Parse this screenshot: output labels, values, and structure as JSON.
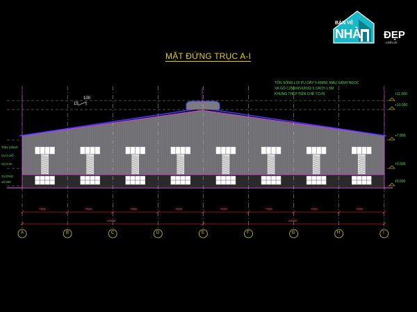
{
  "title": "MẶT ĐỨNG TRỤC A-I",
  "logo": {
    "top_text": "BẢN VẼ",
    "main_text": "NHÀ",
    "accent_text": "ĐẸP",
    "url_text": ".com.vn",
    "color": "#18b8c8"
  },
  "notes": [
    "TÔN SÓNG LỢI PU DÀY 0.45MM, MÀU XANH NGỌC",
    "XÀ GỒ C250X65X20X2.5 CÁCH 1.5M",
    "KHUNG THÉP TIỀN CHẾ TCVN"
  ],
  "elevations": [
    "+11.000",
    "+10.000",
    "+7.800",
    "+3.500",
    "±0.000"
  ],
  "left_labels": [
    "TÔN SÓNG",
    "CỬA SỔ",
    "CỬA ĐI",
    "TƯỜNG",
    "±0.000"
  ],
  "slope_marks": {
    "v": "15",
    "h": "100"
  },
  "bay_dims": [
    "7500",
    "7500",
    "7500",
    "7500",
    "7500",
    "7500",
    "7500",
    "7500"
  ],
  "half_dims": [
    "22500",
    "22500"
  ],
  "axes": [
    "A",
    "B",
    "C",
    "D",
    "E",
    "F",
    "G",
    "H",
    "I"
  ],
  "colors": {
    "roof_line": "#e040e0",
    "wall_fill": "#6e6e72",
    "dim_line": "#ff3030",
    "axis_circle": "#e6d200",
    "text_green": "#4ae34a",
    "grid_line": "#b0b0b0"
  }
}
